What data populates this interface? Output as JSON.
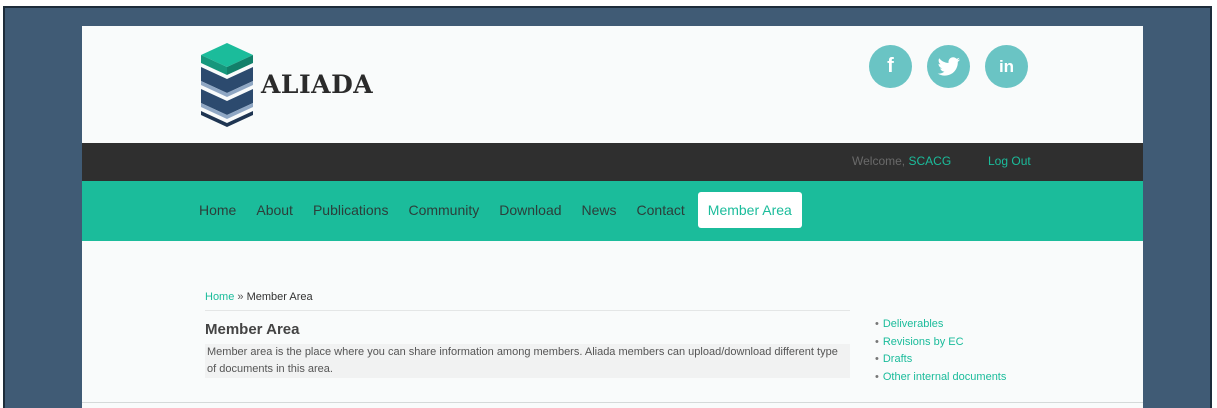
{
  "brand": {
    "name": "ALIADA"
  },
  "social": [
    {
      "icon": "facebook-icon",
      "glyph": "f"
    },
    {
      "icon": "twitter-icon",
      "glyph": "🐦"
    },
    {
      "icon": "linkedin-icon",
      "glyph": "in"
    }
  ],
  "topbar": {
    "welcome": "Welcome,",
    "user": "SCACG",
    "logout": "Log Out"
  },
  "nav": {
    "items": [
      "Home",
      "About",
      "Publications",
      "Community",
      "Download",
      "News",
      "Contact"
    ],
    "active": "Member Area"
  },
  "breadcrumb": {
    "home": "Home",
    "separator": "»",
    "current": "Member Area"
  },
  "main": {
    "title": "Member Area",
    "description": "Member area is the place where you can share information among members. Aliada members can upload/download different type of documents in this area."
  },
  "sidebar": {
    "items": [
      "Deliverables",
      "Revisions by EC",
      "Drafts",
      "Other internal documents"
    ]
  },
  "colors": {
    "accent": "#1bbc9b",
    "frame": "#405b75",
    "topbar": "#2f2f2f",
    "social": "#6ac4c4"
  }
}
